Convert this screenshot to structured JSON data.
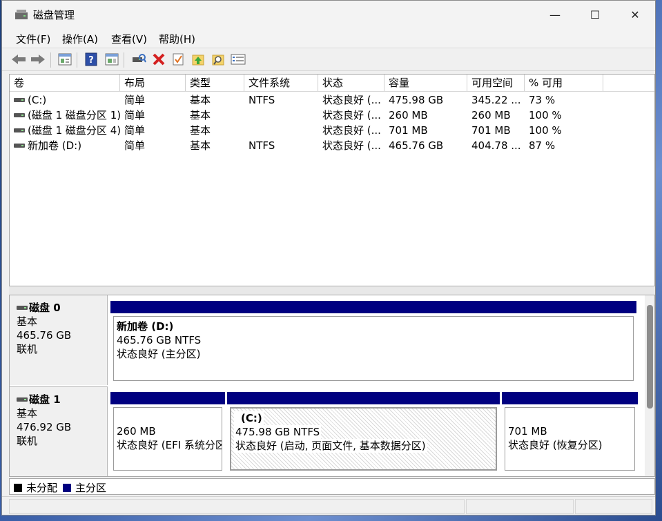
{
  "window": {
    "title": "磁盘管理",
    "minimize_glyph": "—",
    "maximize_glyph": "☐",
    "close_glyph": "✕"
  },
  "menu": [
    {
      "label": "文件(F)"
    },
    {
      "label": "操作(A)"
    },
    {
      "label": "查看(V)"
    },
    {
      "label": "帮助(H)"
    }
  ],
  "toolbar": {
    "icons": [
      "back-arrow-icon",
      "forward-arrow-icon",
      "properties-icon",
      "help-icon",
      "refresh-icon",
      "connect-icon",
      "delete-icon",
      "check-icon",
      "up-folder-icon",
      "search-folder-icon",
      "list-view-icon"
    ]
  },
  "colors": {
    "primary_partition": "#000080",
    "unallocated": "#000000"
  },
  "volume_list": {
    "columns": [
      "卷",
      "布局",
      "类型",
      "文件系统",
      "状态",
      "容量",
      "可用空间",
      "% 可用"
    ],
    "rows": [
      {
        "volume": "(C:)",
        "layout": "简单",
        "type": "基本",
        "fs": "NTFS",
        "status": "状态良好 (...",
        "capacity": "475.98 GB",
        "free": "345.22 ...",
        "pct": "73 %"
      },
      {
        "volume": "(磁盘 1 磁盘分区 1)",
        "layout": "简单",
        "type": "基本",
        "fs": "",
        "status": "状态良好 (...",
        "capacity": "260 MB",
        "free": "260 MB",
        "pct": "100 %"
      },
      {
        "volume": "(磁盘 1 磁盘分区 4)",
        "layout": "简单",
        "type": "基本",
        "fs": "",
        "status": "状态良好 (...",
        "capacity": "701 MB",
        "free": "701 MB",
        "pct": "100 %"
      },
      {
        "volume": "新加卷 (D:)",
        "layout": "简单",
        "type": "基本",
        "fs": "NTFS",
        "status": "状态良好 (...",
        "capacity": "465.76 GB",
        "free": "404.78 ...",
        "pct": "87 %"
      }
    ]
  },
  "disks": [
    {
      "name": "磁盘 0",
      "kind": "基本",
      "size": "465.76 GB",
      "state": "联机",
      "partitions": [
        {
          "title": "新加卷 (D:)",
          "size": "465.76 GB NTFS",
          "status": "状态良好 (主分区)"
        }
      ]
    },
    {
      "name": "磁盘 1",
      "kind": "基本",
      "size": "476.92 GB",
      "state": "联机",
      "partitions": [
        {
          "title": "",
          "size": "260 MB",
          "status": "状态良好 (EFI 系统分区"
        },
        {
          "title": "(C:)",
          "size": "475.98 GB NTFS",
          "status": "状态良好 (启动, 页面文件, 基本数据分区)"
        },
        {
          "title": "",
          "size": "701 MB",
          "status": "状态良好 (恢复分区)"
        }
      ]
    }
  ],
  "legend": [
    {
      "label": "未分配",
      "color": "#000000"
    },
    {
      "label": "主分区",
      "color": "#000080"
    }
  ]
}
